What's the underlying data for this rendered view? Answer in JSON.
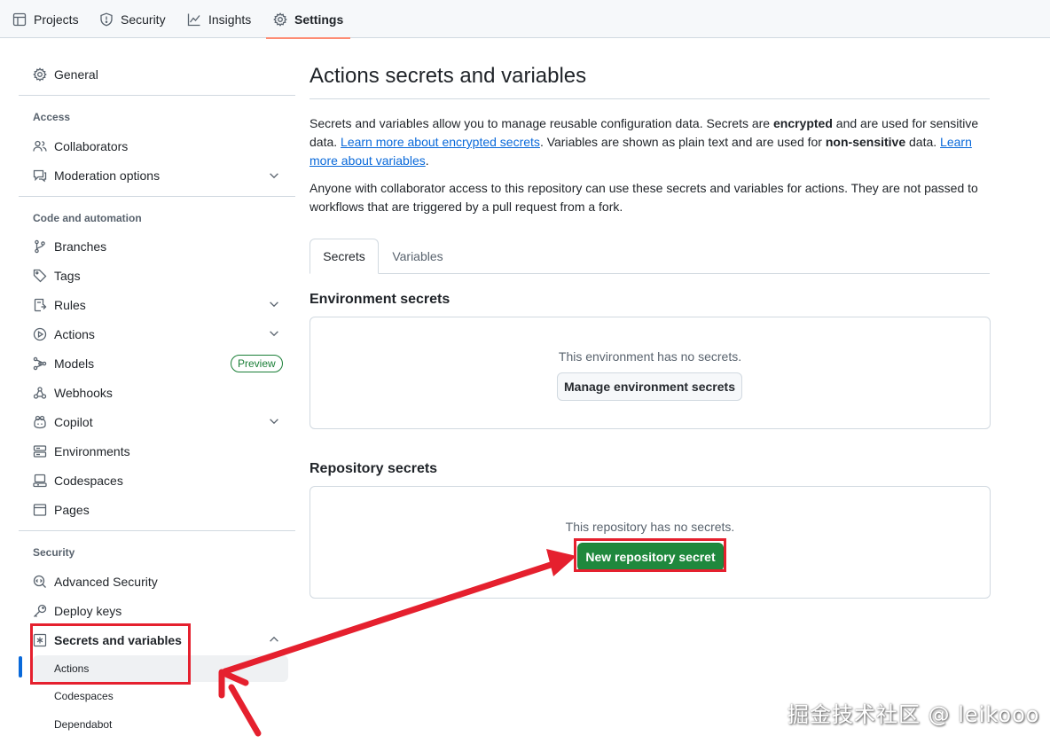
{
  "topnav": {
    "tabs": [
      {
        "label": "Projects",
        "icon": "table-icon"
      },
      {
        "label": "Security",
        "icon": "shield-icon"
      },
      {
        "label": "Insights",
        "icon": "graph-icon"
      },
      {
        "label": "Settings",
        "icon": "gear-icon",
        "active": true
      }
    ]
  },
  "sidebar": {
    "general": "General",
    "access_heading": "Access",
    "collaborators": "Collaborators",
    "moderation": "Moderation options",
    "code_heading": "Code and automation",
    "branches": "Branches",
    "tags": "Tags",
    "rules": "Rules",
    "actions": "Actions",
    "models": "Models",
    "models_badge": "Preview",
    "webhooks": "Webhooks",
    "copilot": "Copilot",
    "environments": "Environments",
    "codespaces": "Codespaces",
    "pages": "Pages",
    "security_heading": "Security",
    "advanced_security": "Advanced Security",
    "deploy_keys": "Deploy keys",
    "secrets_variables": "Secrets and variables",
    "sub_items": [
      "Actions",
      "Codespaces",
      "Dependabot"
    ]
  },
  "main": {
    "title": "Actions secrets and variables",
    "intro_1": "Secrets and variables allow you to manage reusable configuration data. Secrets are ",
    "intro_encrypted": "encrypted",
    "intro_2": " and are used for sensitive data. ",
    "link_secrets": "Learn more about encrypted secrets",
    "intro_3": ". Variables are shown as plain text and are used for ",
    "intro_nonsensitive": "non-sensitive",
    "intro_4": " data. ",
    "link_variables": "Learn more about variables",
    "intro_5": ".",
    "access_note": "Anyone with collaborator access to this repository can use these secrets and variables for actions. They are not passed to workflows that are triggered by a pull request from a fork.",
    "tabs": [
      "Secrets",
      "Variables"
    ],
    "env_title": "Environment secrets",
    "env_empty": "This environment has no secrets.",
    "env_button": "Manage environment secrets",
    "repo_title": "Repository secrets",
    "repo_empty": "This repository has no secrets.",
    "repo_button": "New repository secret"
  },
  "watermark": "掘金技术社区 @ leikooo",
  "colors": {
    "annotation_red": "#e5202e",
    "primary_green": "#1f883d",
    "link_blue": "#0969da",
    "active_tab_underline": "#fd8c73"
  }
}
